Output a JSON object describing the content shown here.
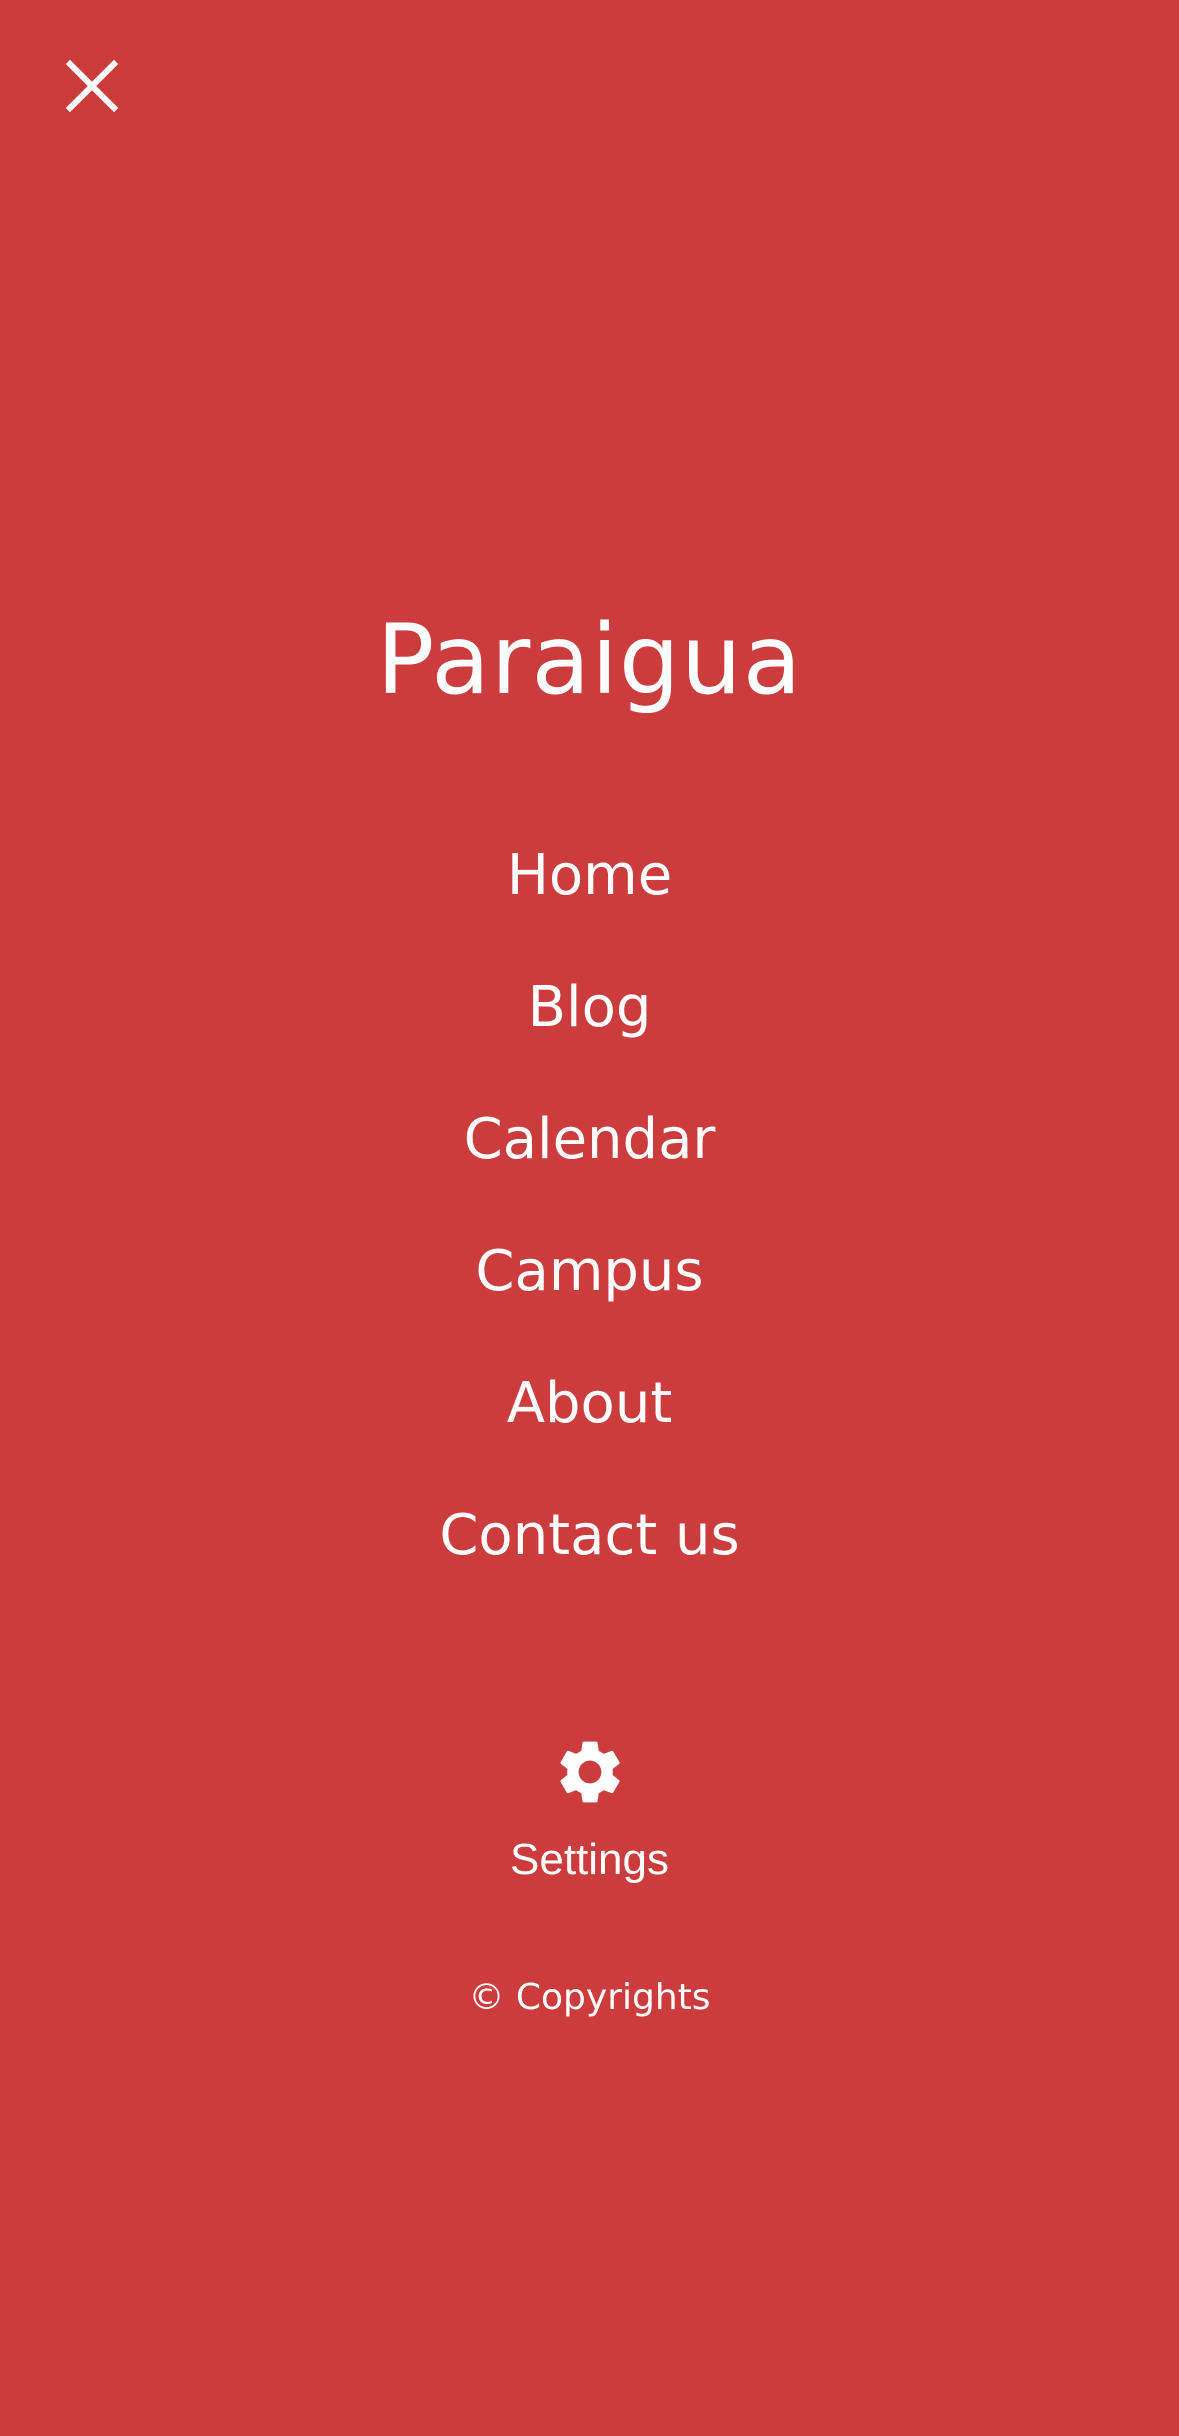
{
  "menu": {
    "close_icon": "close-icon",
    "brand": "Paraigua",
    "items": [
      {
        "label": "Home"
      },
      {
        "label": "Blog"
      },
      {
        "label": "Calendar"
      },
      {
        "label": "Campus"
      },
      {
        "label": "About"
      },
      {
        "label": "Contact us"
      }
    ],
    "settings": {
      "icon": "gear-icon",
      "label": "Settings"
    },
    "copyright": "© Copyrights"
  },
  "colors": {
    "background": "#cd3c3c",
    "foreground": "#ffffff"
  }
}
